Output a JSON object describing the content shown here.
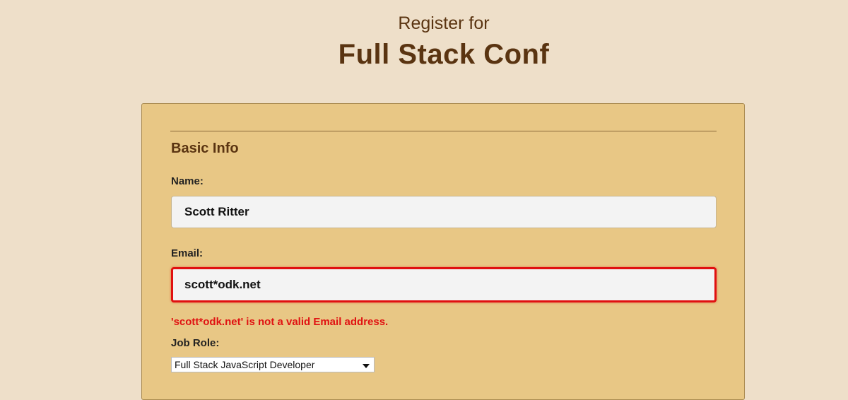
{
  "header": {
    "subtitle": "Register for",
    "title": "Full Stack Conf"
  },
  "form": {
    "section_title": "Basic Info",
    "name": {
      "label": "Name:",
      "value": "Scott Ritter"
    },
    "email": {
      "label": "Email:",
      "value": "scott*odk.net",
      "error": "'scott*odk.net' is not a valid Email address."
    },
    "job_role": {
      "label": "Job Role:",
      "selected": "Full Stack JavaScript Developer"
    }
  },
  "colors": {
    "background": "#eedfc9",
    "card": "#e8c785",
    "heading": "#5a3411",
    "error": "#e01212"
  }
}
